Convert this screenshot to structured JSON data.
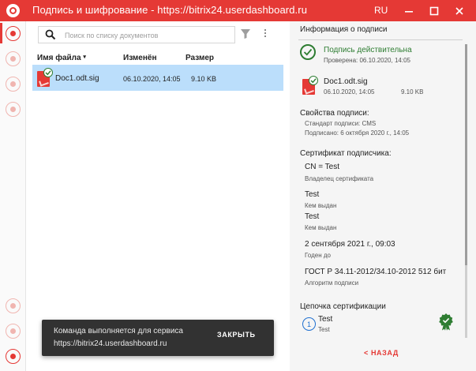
{
  "window": {
    "title": "Подпись и шифрование - https://bitrix24.userdashboard.ru",
    "language": "RU"
  },
  "sidebar": {
    "items": [
      {
        "icon": "signature-icon",
        "active": true
      },
      {
        "icon": "document-icon",
        "active": false
      },
      {
        "icon": "certificate-icon",
        "active": false
      },
      {
        "icon": "contacts-icon",
        "active": false
      }
    ],
    "bottom_items": [
      {
        "icon": "cloud-icon"
      },
      {
        "icon": "settings-icon"
      },
      {
        "icon": "logout-icon"
      }
    ]
  },
  "search": {
    "placeholder": "Поиск по списку документов",
    "value": ""
  },
  "table": {
    "columns": {
      "name": "Имя файла",
      "modified": "Изменён",
      "size": "Размер"
    },
    "rows": [
      {
        "name": "Doc1.odt.sig",
        "modified": "06.10.2020, 14:05",
        "size": "9.10 KB"
      }
    ]
  },
  "info": {
    "heading": "Информация о подписи",
    "status": "Подпись действительна",
    "checked": "Проверена: 06.10.2020, 14:05",
    "file": {
      "name": "Doc1.odt.sig",
      "date": "06.10.2020, 14:05",
      "size": "9.10 KB"
    },
    "props_title": "Свойства подписи:",
    "props_standard": "Стандарт подписи: CMS",
    "props_signed": "Подписано: 6 октября 2020 г., 14:05",
    "cert_title": "Сертификат подписчика:",
    "owner_value": "CN = Test",
    "owner_label": "Владелец сертификата",
    "issuer1_value": "Test",
    "issuer1_label": "Кем выдан",
    "issuer2_value": "Test",
    "issuer2_label": "Кем выдан",
    "valid_value": "2 сентября 2021 г., 09:03",
    "valid_label": "Годен до",
    "algo_value": "ГОСТ Р 34.11-2012/34.10-2012 512 бит",
    "algo_label": "Алгоритм подписи",
    "chain_title": "Цепочка сертификации",
    "chain_num": "1",
    "chain_name": "Test",
    "chain_sub": "Test",
    "back": "< НАЗАД"
  },
  "toast": {
    "line1": "Команда выполняется для сервиса",
    "line2": "https://bitrix24.userdashboard.ru",
    "close": "ЗАКРЫТЬ"
  },
  "colors": {
    "accent": "#e53935",
    "valid": "#2e7d32",
    "selection": "#bbdefb",
    "link": "#1e6fd0"
  }
}
